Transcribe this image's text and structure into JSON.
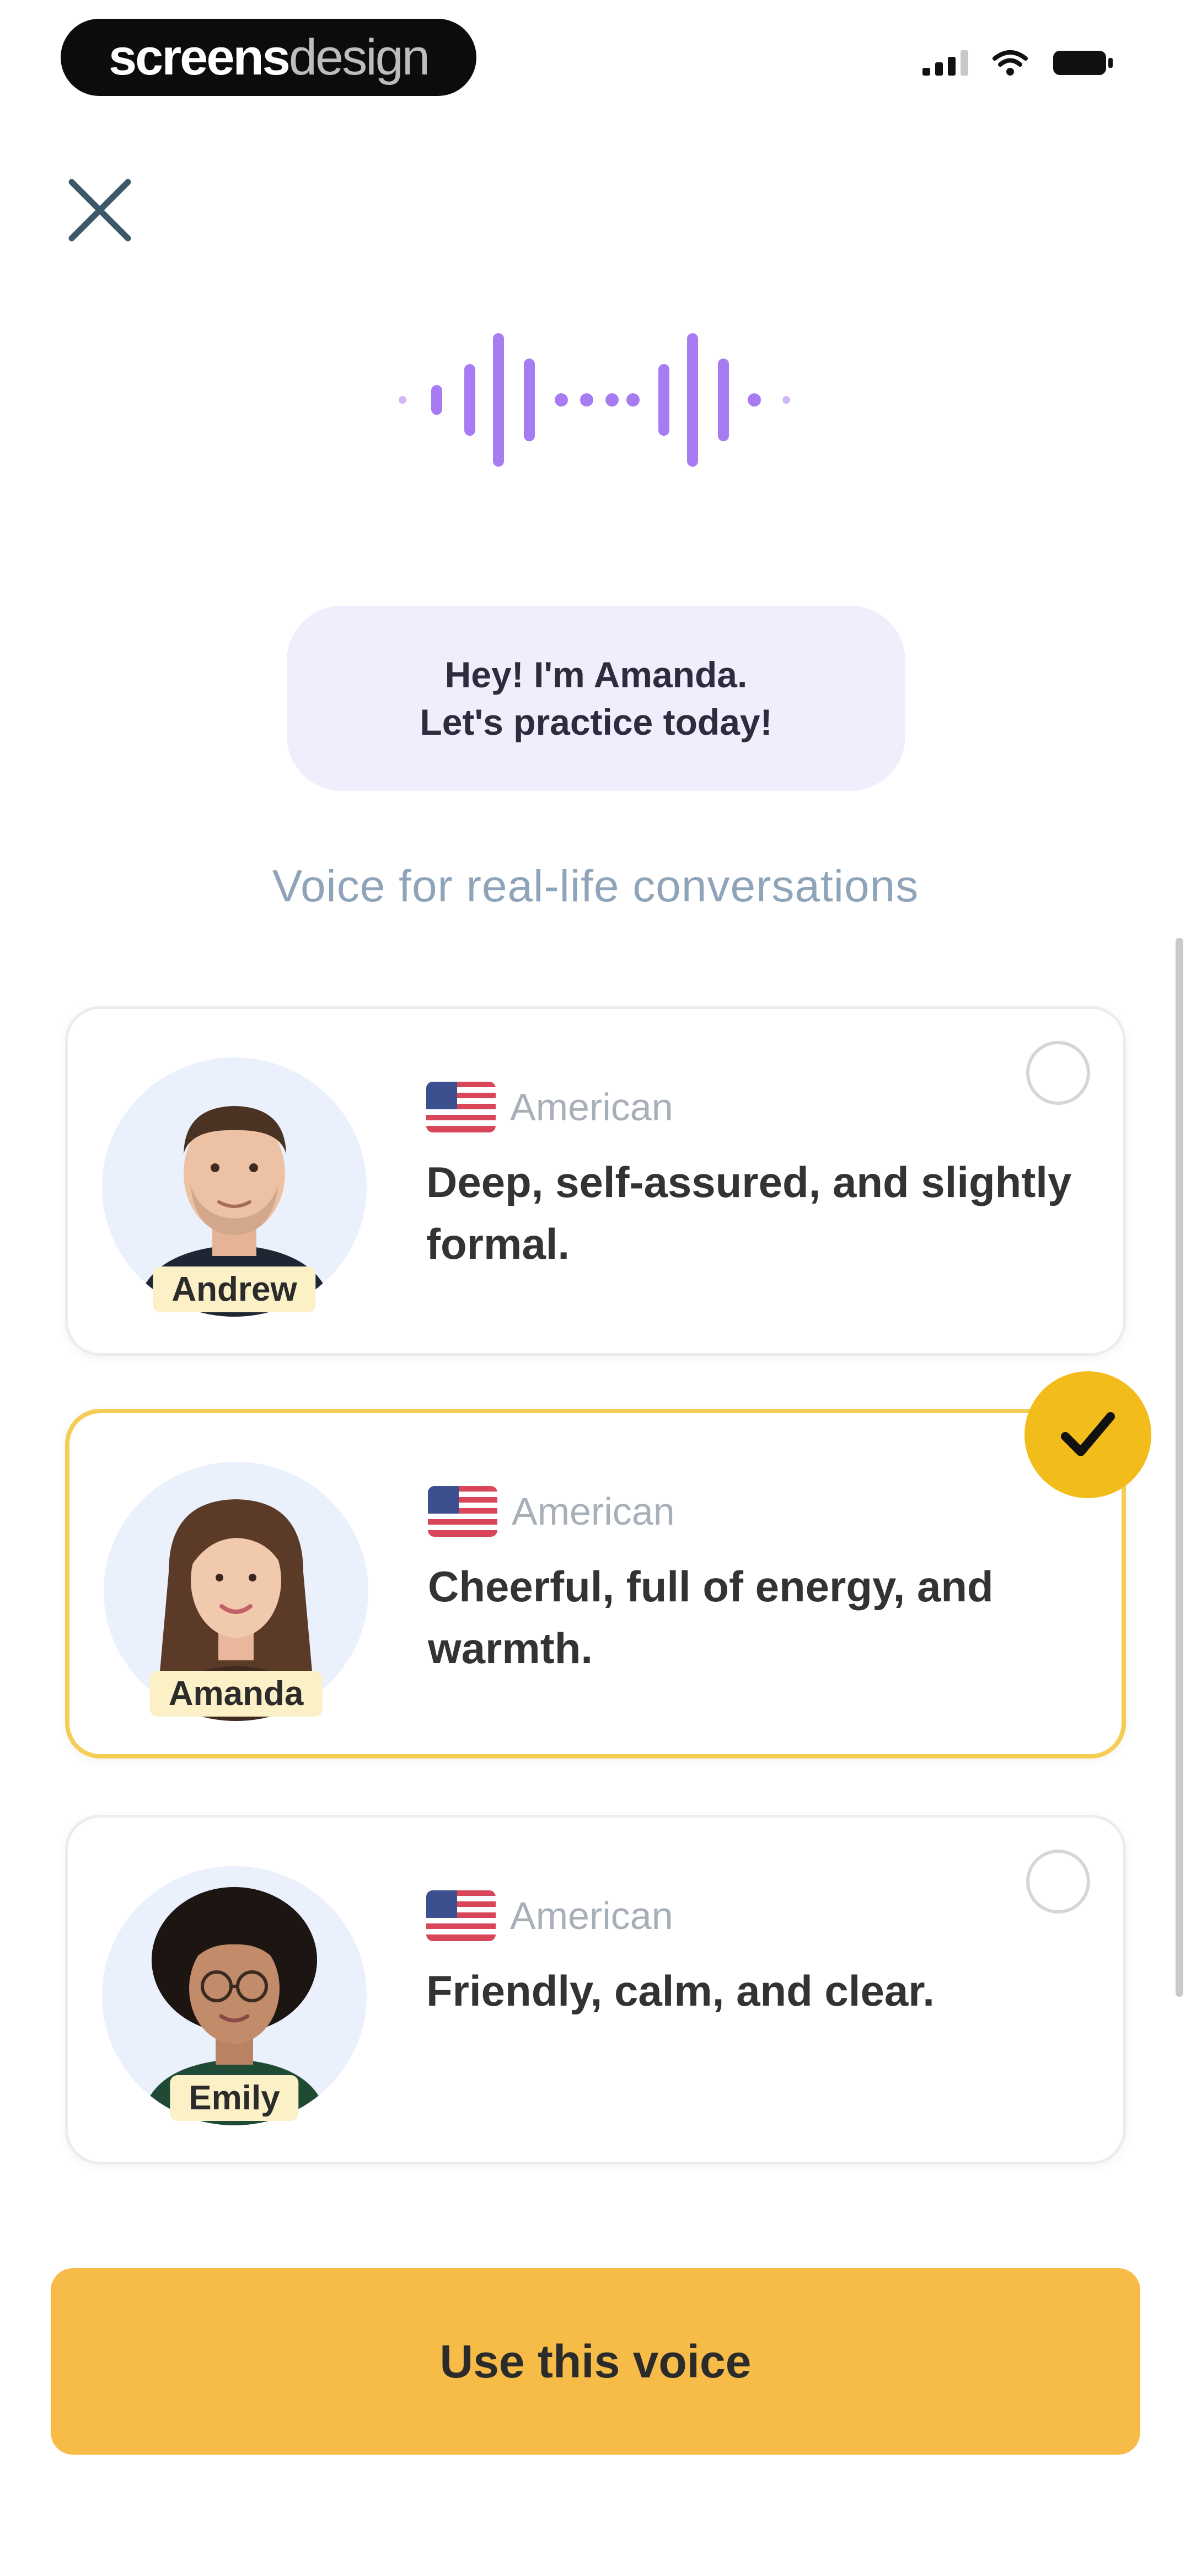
{
  "status_bar": {
    "watermark_bold": "screens",
    "watermark_light": "design",
    "icons": [
      "signal-icon",
      "wifi-icon",
      "battery-icon"
    ]
  },
  "header": {
    "close_icon": "close-icon"
  },
  "speech_bubble": {
    "line1": "Hey! I'm Amanda.",
    "line2": "Let's practice today!"
  },
  "subtitle": "Voice for real-life conversations",
  "voices": [
    {
      "name": "Andrew",
      "accent": "American",
      "description": "Deep, self-assured, and slightly formal.",
      "selected": false
    },
    {
      "name": "Amanda",
      "accent": "American",
      "description": "Cheerful, full of energy, and warmth.",
      "selected": true
    },
    {
      "name": "Emily",
      "accent": "American",
      "description": "Friendly, calm, and clear.",
      "selected": false
    }
  ],
  "cta_label": "Use this voice",
  "colors": {
    "accent_purple": "#a77cf2",
    "bubble_bg": "#f1edfd",
    "selected_border": "#f4cd55",
    "check_badge": "#f2bc1a",
    "cta_bg": "#f7bc48",
    "subtitle": "#8fa4b8"
  }
}
